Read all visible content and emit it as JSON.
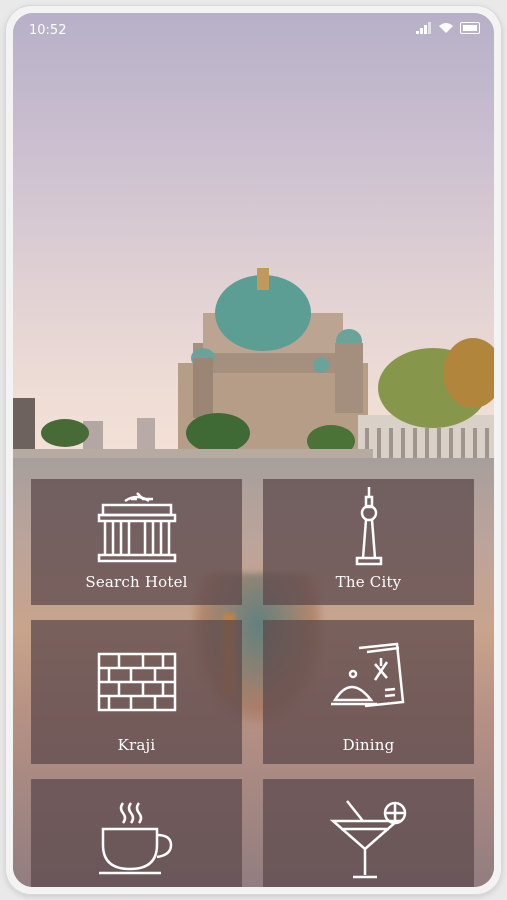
{
  "status_bar": {
    "time": "10:52"
  },
  "tiles": [
    {
      "label": "Search Hotel",
      "icon": "brandenburg-gate-icon"
    },
    {
      "label": "The City",
      "icon": "tv-tower-icon"
    },
    {
      "label": "Kraji",
      "icon": "brick-wall-icon"
    },
    {
      "label": "Dining",
      "icon": "dining-menu-icon"
    },
    {
      "label": "",
      "icon": "coffee-cup-icon"
    },
    {
      "label": "",
      "icon": "cocktail-icon"
    }
  ],
  "colors": {
    "tile_overlay": "#5e4a4c",
    "text": "#ffffff"
  }
}
